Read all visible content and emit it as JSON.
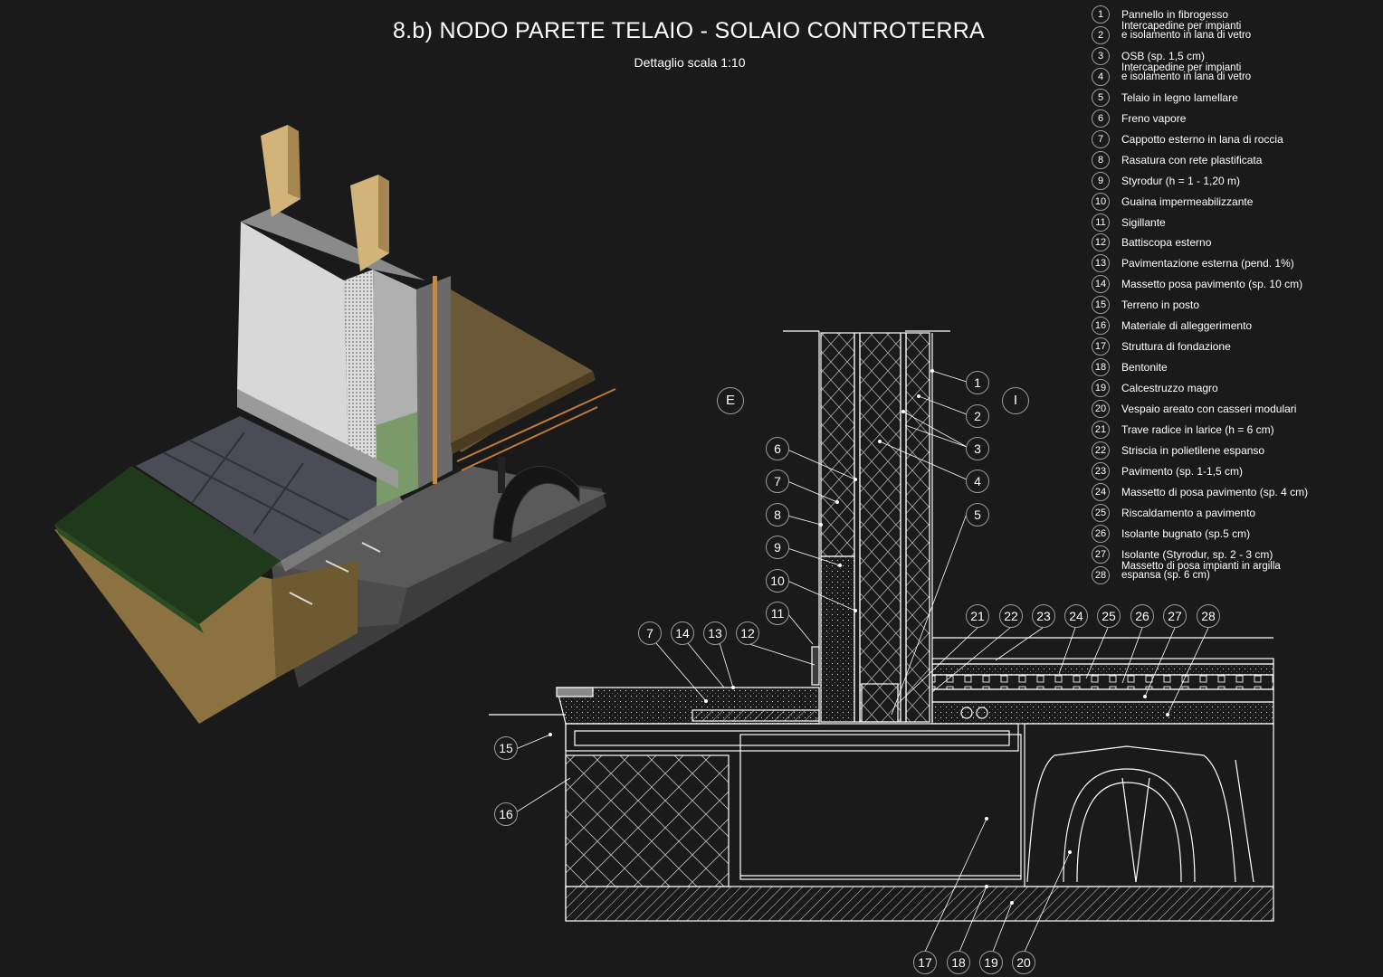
{
  "title": "8.b) NODO PARETE TELAIO - SOLAIO CONTROTERRA",
  "subtitle": "Dettaglio scala 1:10",
  "side_labels": {
    "exterior": "E",
    "interior": "I"
  },
  "legend": [
    {
      "n": "1",
      "text": "Pannello in fibrogesso"
    },
    {
      "n": "2",
      "text": "Intercapedine per impianti\ne isolamento in lana di vetro"
    },
    {
      "n": "3",
      "text": "OSB (sp. 1,5 cm)"
    },
    {
      "n": "4",
      "text": "Intercapedine per impianti\ne isolamento in lana di vetro"
    },
    {
      "n": "5",
      "text": "Telaio in legno lamellare"
    },
    {
      "n": "6",
      "text": "Freno vapore"
    },
    {
      "n": "7",
      "text": "Cappotto esterno in lana di roccia"
    },
    {
      "n": "8",
      "text": "Rasatura con rete plastificata"
    },
    {
      "n": "9",
      "text": "Styrodur (h = 1 - 1,20 m)"
    },
    {
      "n": "10",
      "text": "Guaina impermeabilizzante"
    },
    {
      "n": "11",
      "text": "Sigillante"
    },
    {
      "n": "12",
      "text": "Battiscopa esterno"
    },
    {
      "n": "13",
      "text": "Pavimentazione esterna (pend. 1%)"
    },
    {
      "n": "14",
      "text": "Massetto posa pavimento (sp. 10 cm)"
    },
    {
      "n": "15",
      "text": "Terreno in posto"
    },
    {
      "n": "16",
      "text": "Materiale di alleggerimento"
    },
    {
      "n": "17",
      "text": "Struttura di fondazione"
    },
    {
      "n": "18",
      "text": "Bentonite"
    },
    {
      "n": "19",
      "text": "Calcestruzzo magro"
    },
    {
      "n": "20",
      "text": "Vespaio areato con casseri modulari"
    },
    {
      "n": "21",
      "text": "Trave radice in larice (h = 6 cm)"
    },
    {
      "n": "22",
      "text": "Striscia in polietilene espanso"
    },
    {
      "n": "23",
      "text": "Pavimento (sp. 1-1,5 cm)"
    },
    {
      "n": "24",
      "text": "Massetto di posa pavimento (sp. 4 cm)"
    },
    {
      "n": "25",
      "text": "Riscaldamento a pavimento"
    },
    {
      "n": "26",
      "text": "Isolante bugnato (sp.5 cm)"
    },
    {
      "n": "27",
      "text": "Isolante (Styrodur, sp. 2 - 3 cm)"
    },
    {
      "n": "28",
      "text": "Massetto di posa impianti in argilla\nespansa (sp. 6 cm)"
    }
  ],
  "callouts": {
    "c1": "1",
    "c2": "2",
    "c3": "3",
    "c4": "4",
    "c5": "5",
    "c6": "6",
    "c7a": "7",
    "c8": "8",
    "c9": "9",
    "c10": "10",
    "c11": "11",
    "c7b": "7",
    "c14": "14",
    "c13": "13",
    "c12": "12",
    "c15": "15",
    "c16": "16",
    "c21": "21",
    "c22": "22",
    "c23": "23",
    "c24": "24",
    "c25": "25",
    "c26": "26",
    "c27": "27",
    "c28": "28",
    "c17": "17",
    "c18": "18",
    "c19": "19",
    "c20": "20"
  },
  "colors": {
    "background": "#1a1a1a",
    "line": "#ffffff",
    "circle": "#9a9a9a"
  }
}
